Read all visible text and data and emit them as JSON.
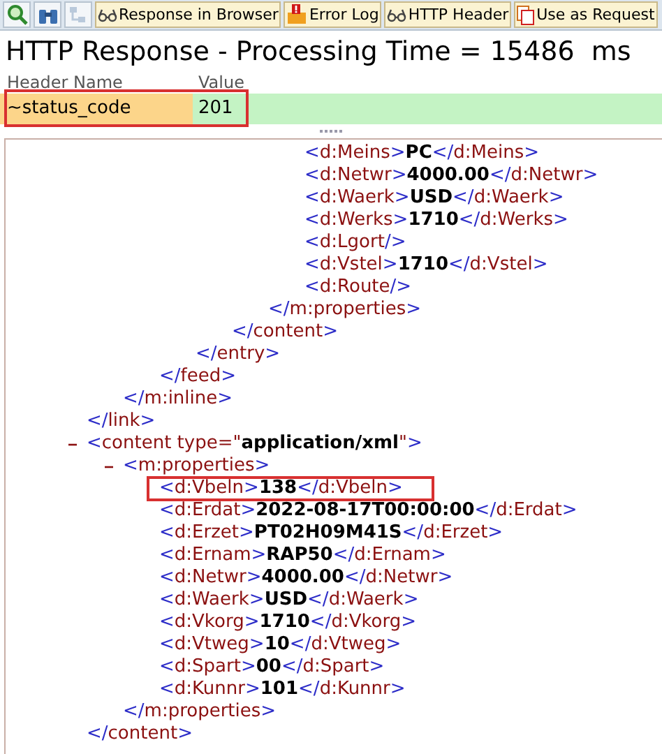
{
  "toolbar": {
    "buttons": [
      {
        "kind": "glasses",
        "label": "Response in Browser"
      },
      {
        "kind": "error",
        "label": "Error Log"
      },
      {
        "kind": "glasses",
        "label": "HTTP Header"
      },
      {
        "kind": "document",
        "label": "Use as Request"
      }
    ]
  },
  "title": "HTTP Response - Processing Time = 15486  ms",
  "header_table": {
    "columns": [
      "Header Name",
      "Value"
    ],
    "rows": [
      {
        "cells": [
          "~status_code",
          "201"
        ],
        "highlighted": true
      }
    ]
  },
  "xml": [
    {
      "kind": "tail",
      "children": [
        {
          "kind": "tail",
          "close": "</link>",
          "children": [
            {
              "kind": "tail",
              "close": "</m:inline>",
              "children": [
                {
                  "kind": "tail",
                  "close": "</feed>",
                  "children": [
                    {
                      "kind": "tail",
                      "close": "</entry>",
                      "children": [
                        {
                          "kind": "tail",
                          "close": "</content>",
                          "children": [
                            {
                              "kind": "tail",
                              "close": "</m:properties>",
                              "children": [
                                {
                                  "kind": "line",
                                  "text": "<d:Meins>**PC**</d:Meins>"
                                },
                                {
                                  "kind": "line",
                                  "text": "<d:Netwr>**4000.00**</d:Netwr>"
                                },
                                {
                                  "kind": "line",
                                  "text": "<d:Waerk>**USD**</d:Waerk>"
                                },
                                {
                                  "kind": "line",
                                  "text": "<d:Werks>**1710**</d:Werks>"
                                },
                                {
                                  "kind": "line",
                                  "text": "<d:Lgort/>"
                                },
                                {
                                  "kind": "line",
                                  "text": "<d:Vstel>**1710**</d:Vstel>"
                                },
                                {
                                  "kind": "line",
                                  "text": "<d:Route/>"
                                }
                              ]
                            }
                          ]
                        }
                      ]
                    }
                  ]
                }
              ]
            }
          ]
        },
        {
          "kind": "container",
          "text": "<content type=\"**application/xml**\">",
          "close": "</content>",
          "expanded": true,
          "children": [
            {
              "kind": "container",
              "text": "<m:properties>",
              "close": "</m:properties>",
              "expanded": true,
              "children": [
                {
                  "kind": "line",
                  "text": "<d:Vbeln>**138**</d:Vbeln>",
                  "highlighted": true
                },
                {
                  "kind": "line",
                  "text": "<d:Erdat>**2022-08-17T00:00:00**</d:Erdat>"
                },
                {
                  "kind": "line",
                  "text": "<d:Erzet>**PT02H09M41S**</d:Erzet>"
                },
                {
                  "kind": "line",
                  "text": "<d:Ernam>**RAP50**</d:Ernam>"
                },
                {
                  "kind": "line",
                  "text": "<d:Netwr>**4000.00**</d:Netwr>"
                },
                {
                  "kind": "line",
                  "text": "<d:Waerk>**USD**</d:Waerk>"
                },
                {
                  "kind": "line",
                  "text": "<d:Vkorg>**1710**</d:Vkorg>"
                },
                {
                  "kind": "line",
                  "text": "<d:Vtweg>**10**</d:Vtweg>"
                },
                {
                  "kind": "line",
                  "text": "<d:Spart>**00**</d:Spart>"
                },
                {
                  "kind": "line",
                  "text": "<d:Kunnr>**101**</d:Kunnr>"
                }
              ]
            }
          ]
        }
      ]
    }
  ]
}
